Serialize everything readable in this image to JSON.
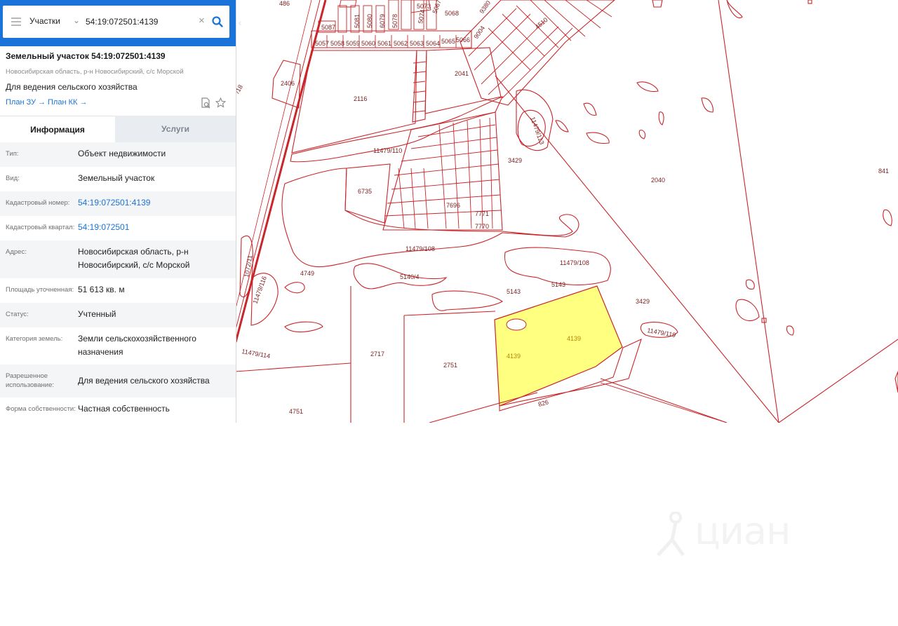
{
  "search": {
    "layer": "Участки",
    "value": "54:19:072501:4139"
  },
  "object": {
    "title": "Земельный участок 54:19:072501:4139",
    "address": "Новосибирская область, р-н Новосибирский, с/с Морской",
    "usage": "Для ведения сельского хозяйства",
    "links": [
      "План ЗУ →",
      "План КК →"
    ]
  },
  "tabs": [
    "Информация",
    "Услуги"
  ],
  "info_rows": [
    {
      "key": "Тип:",
      "value": "Объект недвижимости"
    },
    {
      "key": "Вид:",
      "value": "Земельный участок"
    },
    {
      "key": "Кадастровый номер:",
      "value": "54:19:072501:4139"
    },
    {
      "key": "Кадастровый квартал:",
      "value": "54:19:072501"
    },
    {
      "key": "Адрес:",
      "value": "Новосибирская область, р-н Новосибирский, с/с Морской"
    },
    {
      "key": "Площадь уточненная:",
      "value": "51 613 кв. м"
    },
    {
      "key": "Статус:",
      "value": "Учтенный"
    },
    {
      "key": "Категория земель:",
      "value": "Земли сельскохозяйственного назначения"
    },
    {
      "key": "Разрешенное использование:",
      "value": "Для ведения сельского хозяйства"
    },
    {
      "key": "Форма собственности:",
      "value": "Частная собственность"
    }
  ],
  "map_labels": {
    "l486": "486",
    "l5087": "5087",
    "l5057": "5057",
    "l5058": "5058",
    "l5059": "5059",
    "l5060": "5060",
    "l5061": "5061",
    "l5062": "5062",
    "l5063": "5063",
    "l5064": "5064",
    "l5065": "5065",
    "l5066": "5066",
    "l5073": "5073",
    "l5081": "5081",
    "l5080": "5080",
    "l6079": "6079",
    "l5078": "5078",
    "l5074": "5074",
    "l5067": "5067",
    "l5068": "5068",
    "l9380": "9380",
    "l9004": "9004",
    "l4510": "4510",
    "l2406": "2406",
    "l2116": "2116",
    "l2041": "2041",
    "l11479_110": "11479/110",
    "l11479_113": "11479/113",
    "l3429a": "3429",
    "l2040": "2040",
    "l841": "841",
    "l6735": "6735",
    "l7696": "7696",
    "l7771": "7771",
    "l7770": "7770",
    "l11479_108a": "11479/108",
    "l11479_108b": "11479/108",
    "l4749": "4749",
    "l5140_4": "5140/4",
    "l5143a": "5143",
    "l5143b": "5143",
    "l3429b": "3429",
    "l11479_119": "11479/119",
    "l1072_11": "1072/11",
    "l11479_116": "11479/116",
    "l11479_114": "11479/114",
    "l2717": "2717",
    "l2751": "2751",
    "l4139a": "4139",
    "l4139b": "4139",
    "l826": "826",
    "l4751": "4751",
    "l18": "/18"
  },
  "watermark": "циан",
  "colors": {
    "accent": "#1a73d9",
    "parcel_line": "#c8262a",
    "selected_fill": "#ffff7a"
  }
}
